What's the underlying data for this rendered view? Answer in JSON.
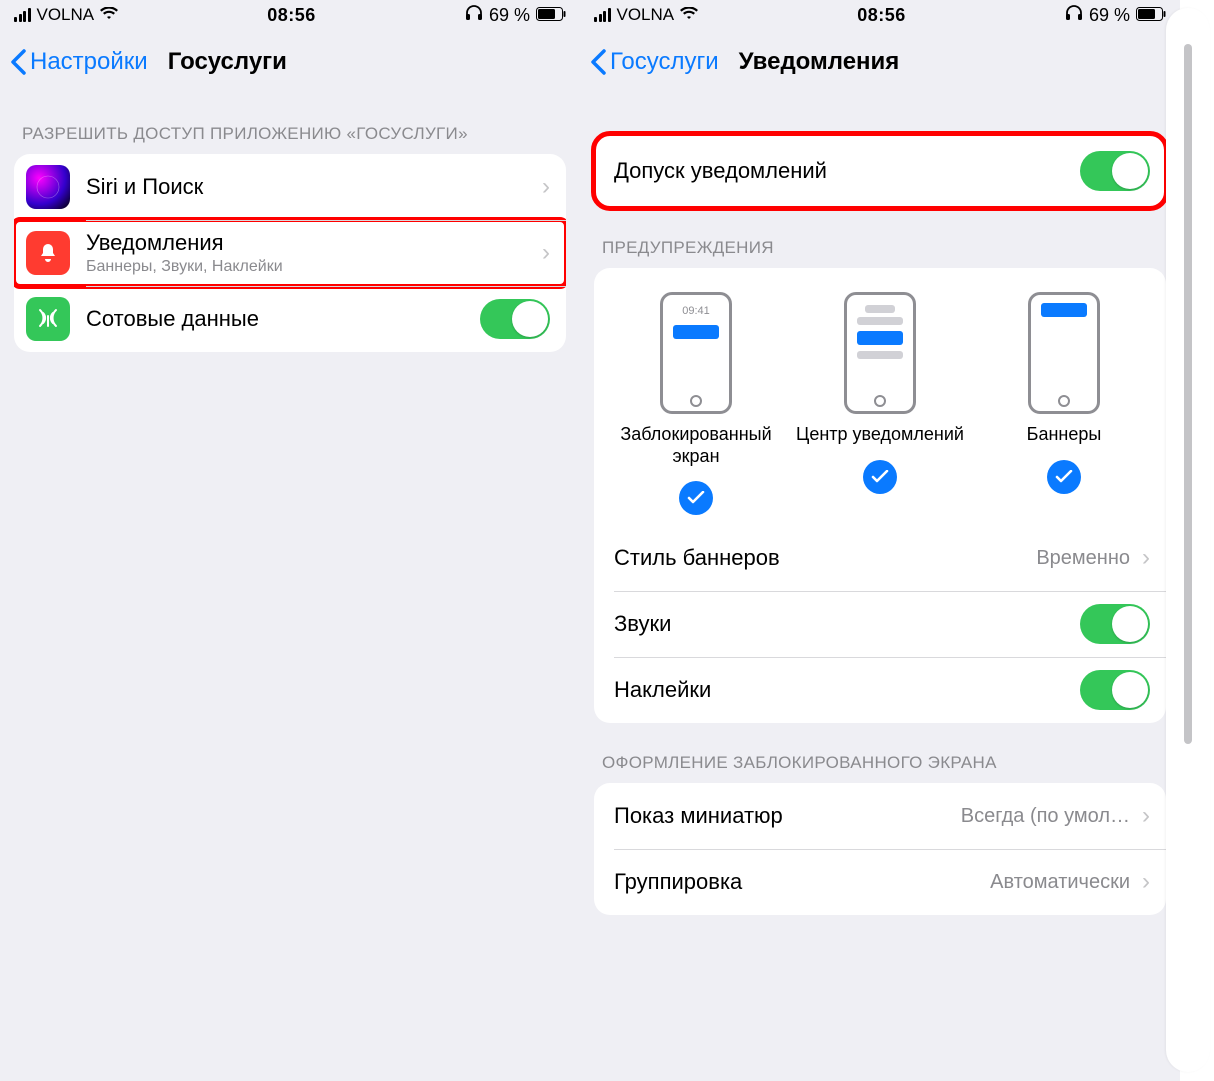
{
  "status": {
    "carrier": "VOLNA",
    "time": "08:56",
    "battery": "69 %"
  },
  "left": {
    "back_label": "Настройки",
    "title": "Госуслуги",
    "section1": "РАЗРЕШИТЬ ДОСТУП ПРИЛОЖЕНИЮ «ГОСУСЛУГИ»",
    "rows": {
      "siri": "Siri и Поиск",
      "notifications": "Уведомления",
      "notifications_sub": "Баннеры, Звуки, Наклейки",
      "cellular": "Сотовые данные"
    }
  },
  "right": {
    "back_label": "Госуслуги",
    "title": "Уведомления",
    "allow": "Допуск уведомлений",
    "alerts_header": "ПРЕДУПРЕЖДЕНИЯ",
    "alerts": {
      "lock_time": "09:41",
      "lock": "Заблокированный экран",
      "center": "Центр уведомлений",
      "banners": "Баннеры"
    },
    "banner_style_label": "Стиль баннеров",
    "banner_style_value": "Временно",
    "sounds": "Звуки",
    "badges": "Наклейки",
    "lock_screen_header": "ОФОРМЛЕНИЕ ЗАБЛОКИРОВАННОГО ЭКРАНА",
    "previews_label": "Показ миниатюр",
    "previews_value": "Всегда (по умол…",
    "grouping_label": "Группировка",
    "grouping_value": "Автоматически"
  }
}
